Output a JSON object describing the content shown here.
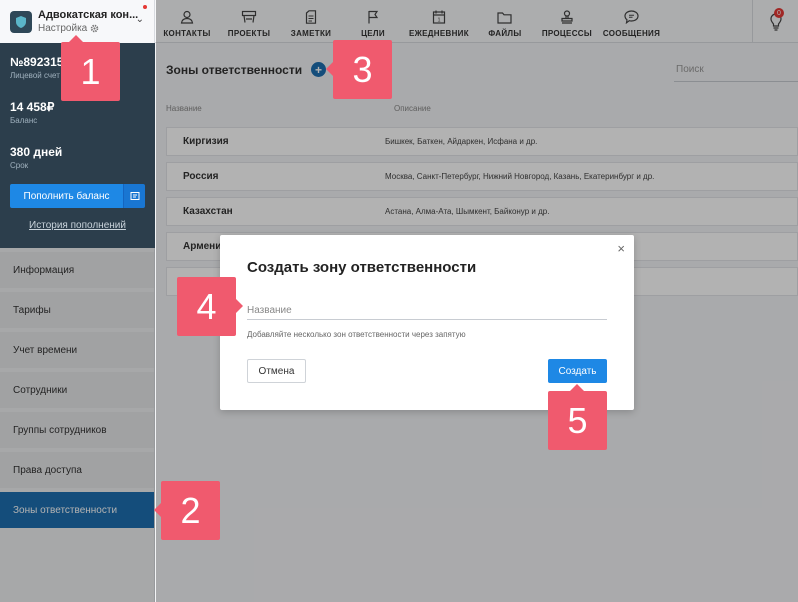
{
  "company": {
    "name": "Адвокатская кон...",
    "settings_label": "Настройка"
  },
  "nav": [
    {
      "label": "КОНТАКТЫ",
      "icon": "person-icon"
    },
    {
      "label": "ПРОЕКТЫ",
      "icon": "projects-icon"
    },
    {
      "label": "ЗАМЕТКИ",
      "icon": "notes-icon"
    },
    {
      "label": "ЦЕЛИ",
      "icon": "flag-icon"
    },
    {
      "label": "ЕЖЕДНЕВНИК",
      "icon": "calendar-icon"
    },
    {
      "label": "ФАЙЛЫ",
      "icon": "folder-icon"
    },
    {
      "label": "ПРОЦЕССЫ",
      "icon": "stamp-icon"
    },
    {
      "label": "СООБЩЕНИЯ",
      "icon": "chat-icon"
    }
  ],
  "notifications": {
    "count": "0"
  },
  "account": {
    "number": "№892315",
    "number_label": "Лицевой счет",
    "balance": "14 458₽",
    "balance_label": "Баланс",
    "days": "380 дней",
    "days_label": "Срок",
    "topup_label": "Пополнить баланс",
    "history_label": "История пополнений"
  },
  "menu": [
    {
      "label": "Информация"
    },
    {
      "label": "Тарифы"
    },
    {
      "label": "Учет времени"
    },
    {
      "label": "Сотрудники"
    },
    {
      "label": "Группы сотрудников"
    },
    {
      "label": "Права доступа"
    },
    {
      "label": "Зоны ответственности",
      "active": true
    }
  ],
  "main": {
    "title": "Зоны ответственности",
    "add_label": "+",
    "search_placeholder": "Поиск",
    "col_name": "Название",
    "col_desc": "Описание",
    "rows": [
      {
        "name": "Киргизия",
        "desc": "Бишкек, Баткен, Айдаркен, Исфана и др."
      },
      {
        "name": "Россия",
        "desc": "Москва, Санкт-Петербург, Нижний Новгород, Казань, Екатеринбург и др."
      },
      {
        "name": "Казахстан",
        "desc": "Астана, Алма-Ата, Шымкент, Байконур и др."
      },
      {
        "name": "Армения",
        "desc": ""
      },
      {
        "name": "",
        "desc": ""
      }
    ]
  },
  "modal": {
    "title": "Создать зону ответственности",
    "close": "×",
    "input_placeholder": "Название",
    "hint": "Добавляйте несколько зон ответственности через запятую",
    "cancel_label": "Отмена",
    "create_label": "Создать"
  },
  "callouts": [
    "1",
    "2",
    "3",
    "4",
    "5"
  ],
  "colors": {
    "accent": "#1e88e5",
    "sidebar_dark": "#2c3e4c",
    "active_menu": "#1e6fb0",
    "callout": "#f05a6e"
  }
}
